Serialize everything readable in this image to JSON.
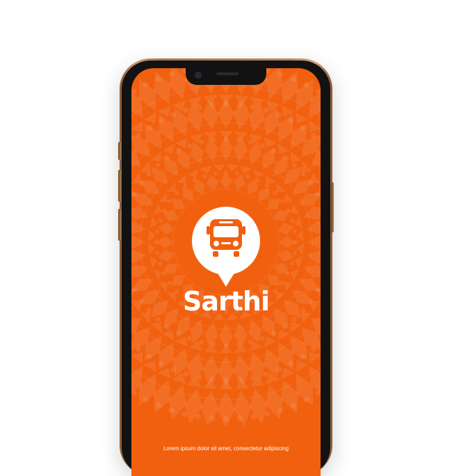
{
  "device": {
    "frame_color": "#b88658",
    "screen_color": "#f1600f"
  },
  "app": {
    "name": "Sarthi",
    "logo_icon": "bus-icon",
    "footer_text": "Lorem ipsum dolor sit amet, consectetur adipiscing"
  }
}
